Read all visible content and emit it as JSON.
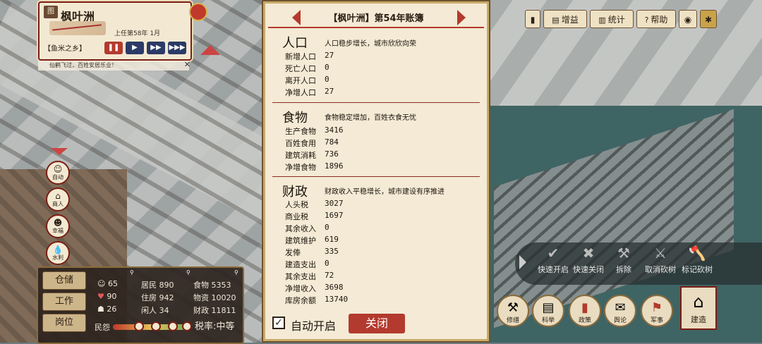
{
  "city": {
    "name": "枫叶洲",
    "badge": "图",
    "date": "上任第58年 1月",
    "slogan": "【鱼米之乡】",
    "speed_buttons": [
      "❚❚",
      "▶",
      "▶▶",
      "▶▶▶"
    ],
    "ticker": "仙鹤飞过，百姓安居乐业！"
  },
  "side_buttons": [
    {
      "icon": "☺",
      "label": "自动"
    },
    {
      "icon": "⌂",
      "label": "商人"
    },
    {
      "icon": "☻",
      "label": "幸福"
    },
    {
      "icon": "💧",
      "label": "水利"
    }
  ],
  "stats_panel": {
    "buttons": [
      "仓储",
      "工作",
      "岗位"
    ],
    "cells": [
      {
        "icon": "☺",
        "value": "65"
      },
      {
        "label": "居民",
        "value": "890"
      },
      {
        "label": "食物",
        "value": "5353"
      },
      {
        "icon": "♥",
        "value": "90"
      },
      {
        "label": "住房",
        "value": "942"
      },
      {
        "label": "物资",
        "value": "10020"
      },
      {
        "icon": "☗",
        "value": "26"
      },
      {
        "label": "闲人",
        "value": "34"
      },
      {
        "label": "财政",
        "value": "11811"
      }
    ],
    "mood_label": "民怨",
    "tax": "税率:中等"
  },
  "toolbar": {
    "book_icon": "▮",
    "boost": "增益",
    "stats": "统计",
    "help": "帮助",
    "eye_icon": "◉",
    "gear_icon": "✱"
  },
  "actions": [
    "快速开启",
    "快速关闭",
    "拆除",
    "取消砍树",
    "标记砍树"
  ],
  "round_buttons": [
    "修缮",
    "科举",
    "政策",
    "舆论",
    "军事"
  ],
  "build": "建造",
  "ledger": {
    "title": "【枫叶洲】第54年账簿",
    "sections": [
      {
        "title": "人口",
        "summary": "人口稳步增长，城市欣欣向荣",
        "rows": [
          {
            "label": "新增人口",
            "value": "27"
          },
          {
            "label": "死亡人口",
            "value": "0"
          },
          {
            "label": "离开人口",
            "value": "0"
          },
          {
            "label": "净增人口",
            "value": "27"
          }
        ]
      },
      {
        "title": "食物",
        "summary": "食物稳定增加，百姓衣食无忧",
        "rows": [
          {
            "label": "生产食物",
            "value": "3416"
          },
          {
            "label": "百姓食用",
            "value": "784"
          },
          {
            "label": "建筑消耗",
            "value": "736"
          },
          {
            "label": "净增食物",
            "value": "1896"
          }
        ]
      },
      {
        "title": "财政",
        "summary": "财政收入平稳增长，城市建设有序推进",
        "rows": [
          {
            "label": "人头税",
            "value": "3027"
          },
          {
            "label": "商业税",
            "value": "1697"
          },
          {
            "label": "其余收入",
            "value": "0"
          },
          {
            "label": "建筑维护",
            "value": "619"
          },
          {
            "label": "发俸",
            "value": "335"
          },
          {
            "label": "建造支出",
            "value": "0"
          },
          {
            "label": "其余支出",
            "value": "72"
          },
          {
            "label": "净增收入",
            "value": "3698"
          },
          {
            "label": "库房余额",
            "value": "13740"
          }
        ]
      }
    ],
    "auto_open_label": "自动开启",
    "auto_open_checked": true,
    "checkmark": "✓",
    "close_label": "关闭"
  }
}
